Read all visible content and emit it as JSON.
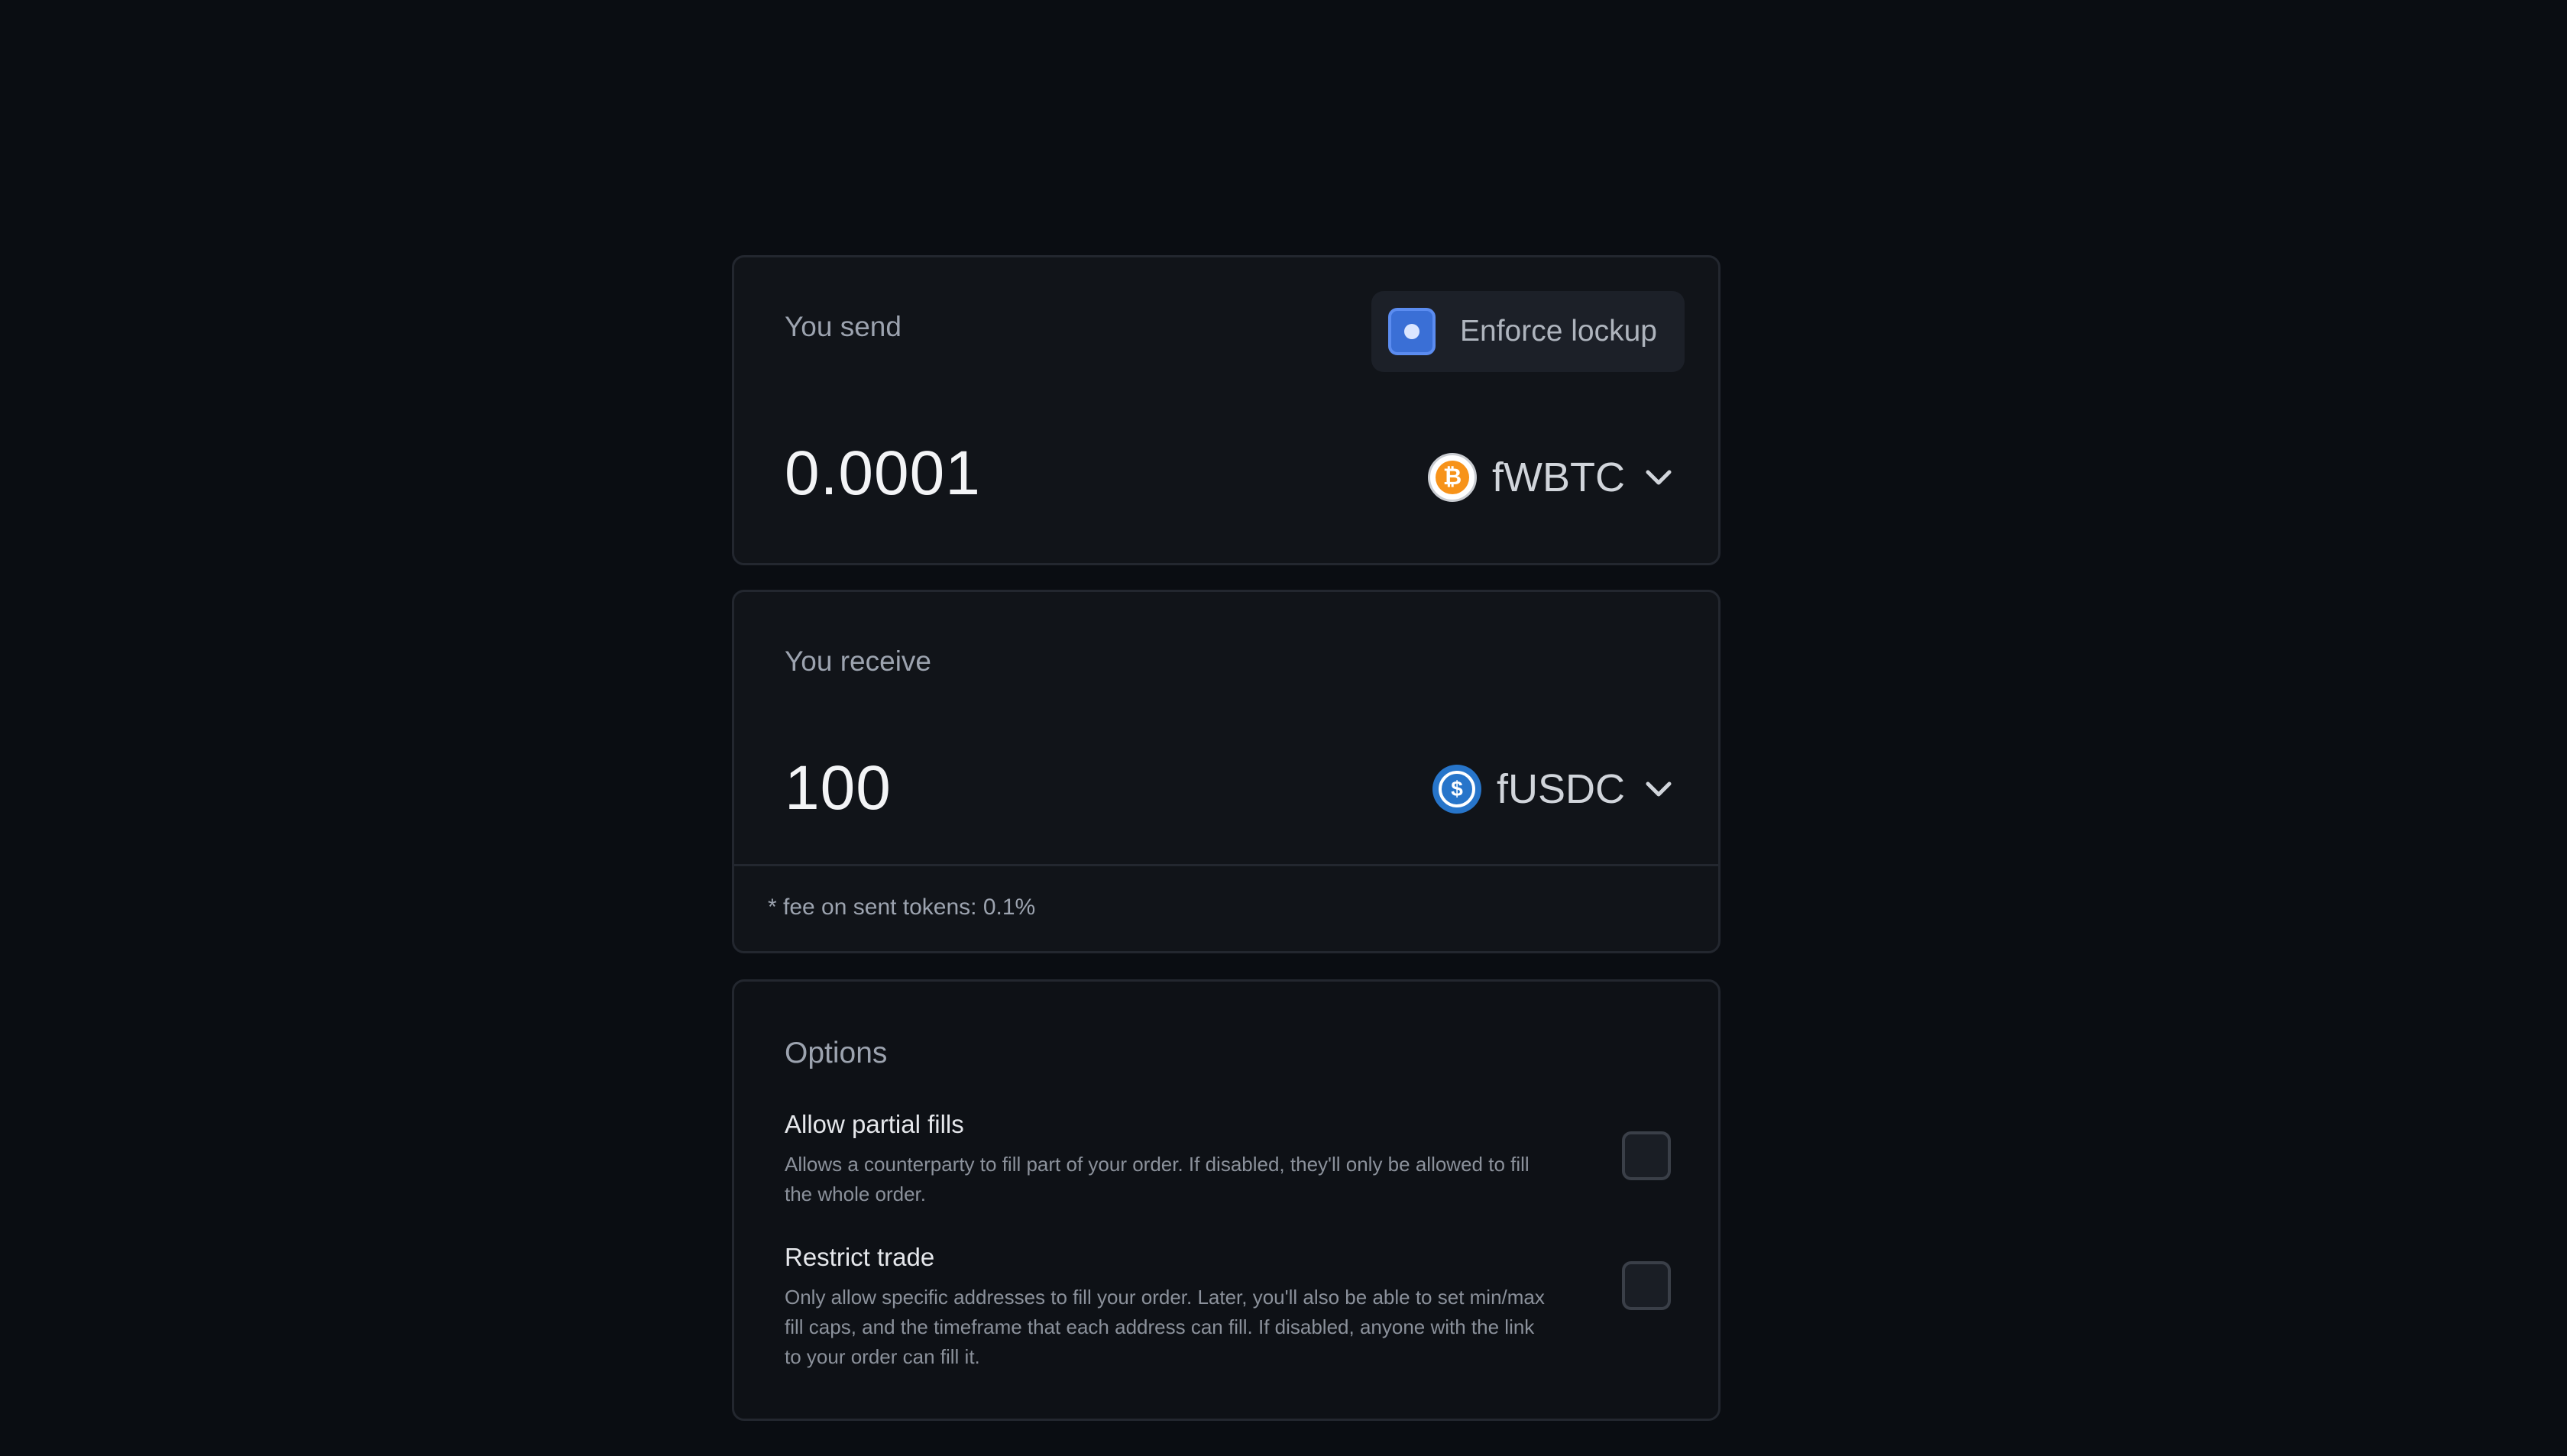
{
  "send": {
    "label": "You send",
    "amount": "0.0001",
    "token": "fWBTC",
    "token_icon": "bitcoin-icon",
    "lockup_label": "Enforce lockup",
    "lockup_checked": true
  },
  "receive": {
    "label": "You receive",
    "amount": "100",
    "token": "fUSDC",
    "token_icon": "usdc-icon",
    "fee_note": "* fee on sent tokens: 0.1%"
  },
  "options": {
    "title": "Options",
    "items": [
      {
        "name": "Allow partial fills",
        "description": "Allows a counterparty to fill part of your order. If disabled, they'll only be allowed to fill the whole order.",
        "checked": false
      },
      {
        "name": "Restrict trade",
        "description": "Only allow specific addresses to fill your order. Later, you'll also be able to set min/max fill caps, and the timeframe that each address can fill. If disabled, anyone with the link to your order can fill it.",
        "checked": false
      }
    ]
  },
  "colors": {
    "background": "#0a0d12",
    "card": "#111419",
    "accent": "#3a6fd6",
    "bitcoin": "#f7931a",
    "usdc": "#2775ca"
  }
}
